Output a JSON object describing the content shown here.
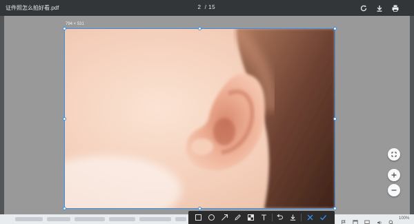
{
  "header": {
    "file_title": "证件照怎么拍好看.pdf",
    "page_current": "2",
    "page_separator": "/",
    "page_total": "15"
  },
  "selection": {
    "size_label": "794 × 531"
  },
  "statusbar": {
    "zoom": "100%"
  },
  "toolbar": {
    "tools": [
      "rectangle",
      "ellipse",
      "arrow",
      "pencil",
      "mosaic",
      "text",
      "undo",
      "download",
      "cancel",
      "confirm"
    ]
  },
  "colors": {
    "accent": "#3a8ee6",
    "topbar": "#323639",
    "toolbar": "#2b2b2b"
  }
}
